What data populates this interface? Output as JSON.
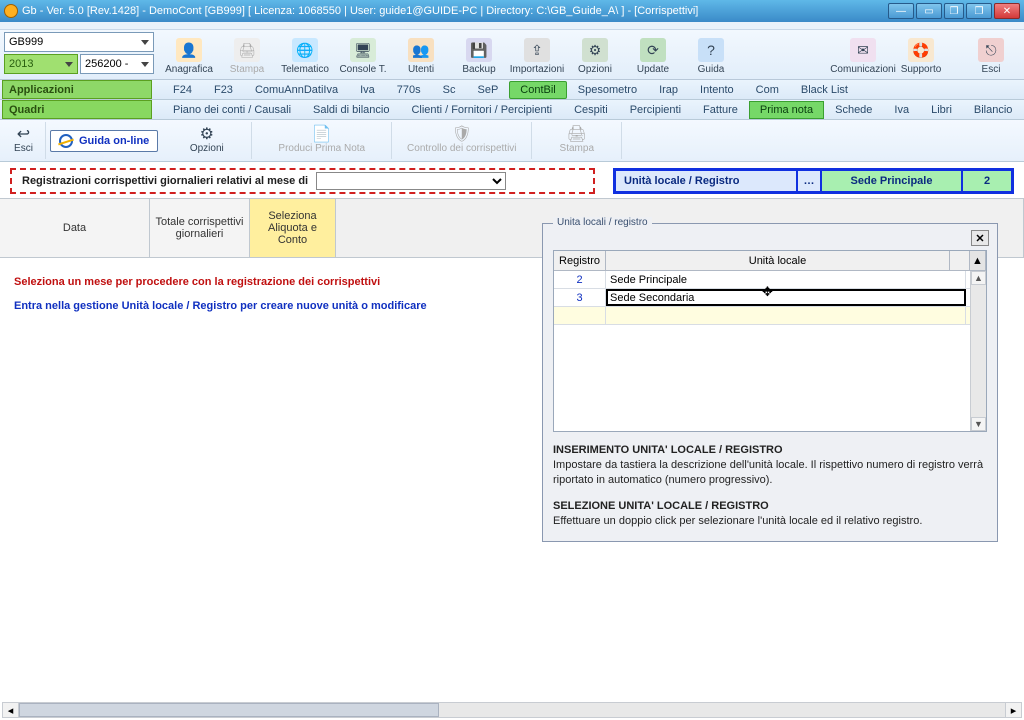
{
  "window": {
    "title": "Gb - Ver. 5.0 [Rev.1428] -   DemoCont [GB999]       [ Licenza: 1068550 | User: guide1@GUIDE-PC | Directory: C:\\GB_Guide_A\\ ] - [Corrispettivi]"
  },
  "top_combos": {
    "client": "GB999",
    "year": "2013",
    "code": "256200 -"
  },
  "toolbar_main": {
    "anagrafica": "Anagrafica",
    "stampa": "Stampa",
    "telematico": "Telematico",
    "console": "Console T.",
    "utenti": "Utenti",
    "backup": "Backup",
    "importazioni": "Importazioni",
    "opzioni": "Opzioni",
    "update": "Update",
    "guida": "Guida",
    "comunicazioni": "Comunicazioni",
    "supporto": "Supporto",
    "esci": "Esci"
  },
  "nav": {
    "applicazioni": "Applicazioni",
    "tabs": {
      "f24": "F24",
      "f23": "F23",
      "comu": "ComuAnnDatiIva",
      "iva": "Iva",
      "s770": "770s",
      "sc": "Sc",
      "sep": "SeP",
      "contbil": "ContBil",
      "speso": "Spesometro",
      "irap": "Irap",
      "intento": "Intento",
      "com": "Com",
      "black": "Black List"
    }
  },
  "quadri": {
    "label": "Quadri",
    "tabs": {
      "piano": "Piano dei conti / Causali",
      "saldi": "Saldi di bilancio",
      "clienti": "Clienti / Fornitori / Percipienti",
      "cespiti": "Cespiti",
      "percip": "Percipienti",
      "fatture": "Fatture",
      "prima": "Prima nota",
      "schede": "Schede",
      "iva": "Iva",
      "libri": "Libri",
      "bilancio": "Bilancio"
    }
  },
  "sectool": {
    "esci": "Esci",
    "guida_link": "Guida on-line",
    "opzioni": "Opzioni",
    "produci": "Produci Prima Nota",
    "controllo": "Controllo dei corrispettivi",
    "stampa": "Stampa"
  },
  "redbar": {
    "label": "Registrazioni corrispettivi giornalieri relativi al mese di"
  },
  "bluebar": {
    "label": "Unità locale / Registro",
    "dots": "…",
    "sede": "Sede Principale",
    "num": "2"
  },
  "gridhead": {
    "data": "Data",
    "tot": "Totale corrispettivi giornalieri",
    "aliq": "Seleziona Aliquota e Conto"
  },
  "messages": {
    "m1": "Seleziona un mese per procedere con la registrazione dei corrispettivi",
    "m2": "Entra nella gestione Unità locale / Registro per creare nuove unità o modificare"
  },
  "popup": {
    "legend": "Unita locali / registro",
    "head_reg": "Registro",
    "head_loc": "Unità locale",
    "rows": [
      {
        "reg": "2",
        "loc": "Sede Principale"
      },
      {
        "reg": "3",
        "loc": "Sede Secondaria"
      }
    ],
    "ins_title": "INSERIMENTO UNITA' LOCALE / REGISTRO",
    "ins_text": "Impostare da tastiera la descrizione dell'unità locale. Il rispettivo numero di registro verrà riportato in automatico (numero progressivo).",
    "sel_title": "SELEZIONE UNITA' LOCALE / REGISTRO",
    "sel_text": "Effettuare un doppio click per selezionare l'unità locale ed il relativo registro."
  }
}
